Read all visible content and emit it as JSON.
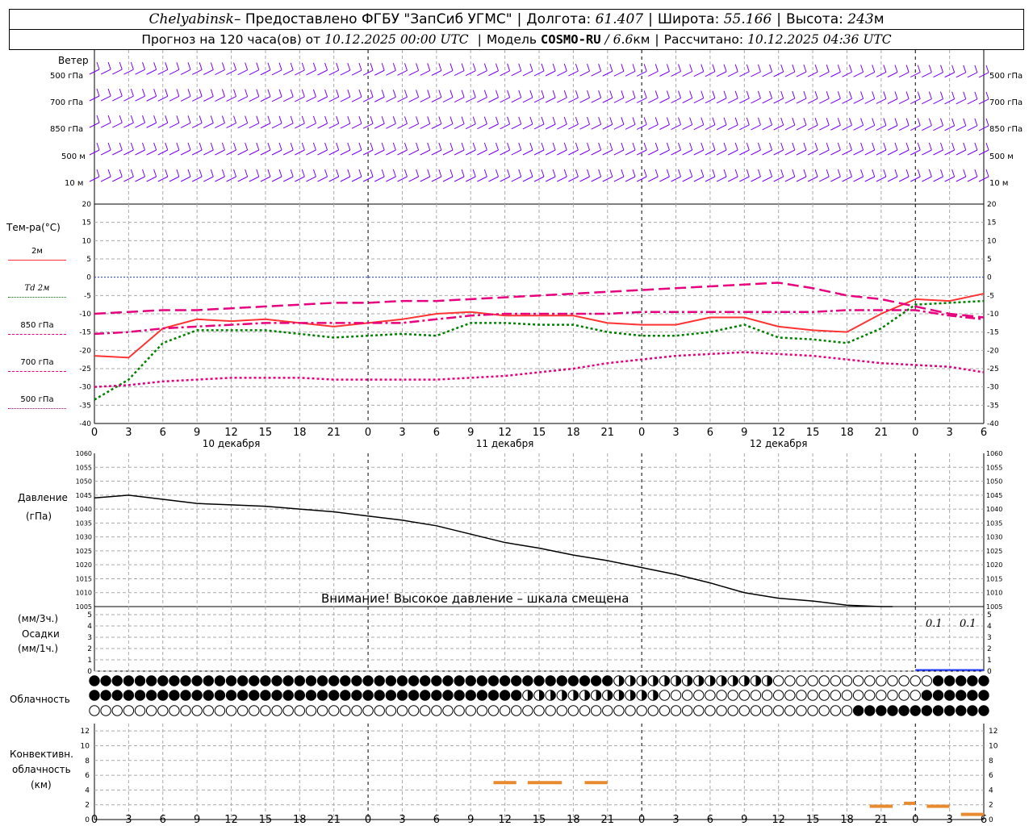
{
  "header": {
    "city": "Chelyabinsk",
    "provider": " – Предоставлено ФГБУ \"ЗапСиб УГМС\"",
    "lon_label": "Долгота:",
    "lon_value": "61.407",
    "lat_label": "Широта:",
    "lat_value": "55.166",
    "alt_label": "Высота:",
    "alt_value": "243",
    "alt_unit": "м",
    "forecast_prefix": "Прогноз на 120 часа(ов) от",
    "forecast_start": "10.12.2025 00:00 UTC",
    "model_label": "Модель",
    "model_name": "COSMO-RU",
    "model_res": "/ 6.6",
    "model_res_unit": "км",
    "calc_label": "Рассчитано:",
    "calc_time": "10.12.2025 04:36 UTC"
  },
  "wind": {
    "title": "Ветер",
    "levels": [
      "500 гПа",
      "700 гПа",
      "850 гПа",
      "500 м",
      "10  м"
    ]
  },
  "temp": {
    "title": "Тем-ра(°C)",
    "legend": [
      {
        "label": "2м",
        "color": "#ff3333"
      },
      {
        "label": "Td  2м",
        "color": "#008000"
      },
      {
        "label": "850 гПа",
        "color": "#e6007e"
      },
      {
        "label": "700 гПа",
        "color": "#e6007e"
      },
      {
        "label": "500 гПа",
        "color": "#e6007e"
      }
    ]
  },
  "pressure": {
    "title": "Давление",
    "unit": "(гПа)",
    "warning": "Внимание! Высокое давление – шкала смещена"
  },
  "precip": {
    "unit3": "(мм/3ч.)",
    "title": "Осадки",
    "unit1": "(мм/1ч.)",
    "labels": [
      "0.1",
      "0.1"
    ]
  },
  "clouds": {
    "title": "Облачность"
  },
  "convective": {
    "title1": "Конвективн.",
    "title2": "облачность",
    "unit": "(км)"
  },
  "time_axis": {
    "ticks": [
      "0",
      "3",
      "6",
      "9",
      "12",
      "15",
      "18",
      "21",
      "0",
      "3",
      "6",
      "9",
      "12",
      "15",
      "18",
      "21",
      "0",
      "3",
      "6",
      "9",
      "12",
      "15",
      "18",
      "21",
      "0",
      "3",
      "6"
    ],
    "days": [
      "10 декабря",
      "11 декабря",
      "12 декабря"
    ]
  },
  "chart_data": [
    {
      "type": "line",
      "title": "Тем-ра(°C)",
      "x": [
        0,
        3,
        6,
        9,
        12,
        15,
        18,
        21,
        24,
        27,
        30,
        33,
        36,
        39,
        42,
        45,
        48,
        51,
        54,
        57,
        60,
        63,
        66,
        69,
        72,
        75,
        78
      ],
      "ylim": [
        -40,
        20
      ],
      "yticks": [
        20,
        15,
        10,
        5,
        0,
        -5,
        -10,
        -15,
        -20,
        -25,
        -30,
        -35,
        -40
      ],
      "grid": true,
      "series": [
        {
          "name": "2м",
          "color": "#ff3333",
          "style": "solid",
          "values": [
            -21.5,
            -22,
            -14,
            -11.5,
            -12,
            -11.5,
            -12.5,
            -13.5,
            -12.5,
            -11.5,
            -10,
            -9.5,
            -10.5,
            -10.5,
            -10.5,
            -12.5,
            -13,
            -13,
            -11,
            -11,
            -13.5,
            -14.5,
            -15,
            -10,
            -6,
            -6.5,
            -4.5
          ]
        },
        {
          "name": "Td  2м",
          "color": "#008000",
          "style": "dotted",
          "values": [
            -33.5,
            -28,
            -18,
            -14.5,
            -14.5,
            -14.5,
            -15.5,
            -16.5,
            -16,
            -15.5,
            -16,
            -12.5,
            -12.5,
            -13,
            -13,
            -15,
            -16,
            -16,
            -15,
            -13,
            -16.5,
            -17,
            -18,
            -14,
            -7.5,
            -7,
            -6.5
          ]
        },
        {
          "name": "850 гПа",
          "color": "#e6007e",
          "style": "dashed",
          "values": [
            -10,
            -9.5,
            -9,
            -9,
            -8.5,
            -8,
            -7.5,
            -7,
            -7,
            -6.5,
            -6.5,
            -6,
            -5.5,
            -5,
            -4.5,
            -4,
            -3.5,
            -3,
            -2.5,
            -2,
            -1.5,
            -3,
            -5,
            -6,
            -8,
            -10,
            -11
          ]
        },
        {
          "name": "700 гПа",
          "color": "#e6007e",
          "style": "dashdot",
          "values": [
            -15.5,
            -15,
            -14,
            -13.5,
            -13,
            -12.5,
            -12.5,
            -12.5,
            -12.5,
            -12.5,
            -11.5,
            -10.5,
            -10,
            -10,
            -10,
            -10,
            -9.5,
            -9.5,
            -9.5,
            -9.5,
            -9.5,
            -9.5,
            -9,
            -9,
            -9,
            -10.5,
            -11.5
          ]
        },
        {
          "name": "500 гПа",
          "color": "#e6007e",
          "style": "dotted",
          "values": [
            -30,
            -29.5,
            -28.5,
            -28,
            -27.5,
            -27.5,
            -27.5,
            -28,
            -28,
            -28,
            -28,
            -27.5,
            -27,
            -26,
            -25,
            -23.5,
            -22.5,
            -21.5,
            -21,
            -20.5,
            -21,
            -21.5,
            -22.5,
            -23.5,
            -24,
            -24.5,
            -26
          ]
        }
      ]
    },
    {
      "type": "line",
      "title": "Давление",
      "ylabel": "(гПа)",
      "ylim": [
        1005,
        1060
      ],
      "yticks": [
        1060,
        1055,
        1050,
        1045,
        1040,
        1035,
        1030,
        1025,
        1020,
        1015,
        1010,
        1005
      ],
      "x": [
        0,
        3,
        6,
        9,
        12,
        15,
        18,
        21,
        24,
        27,
        30,
        33,
        36,
        39,
        42,
        45,
        48,
        51,
        54,
        57,
        60,
        63,
        66,
        69,
        70
      ],
      "series": [
        {
          "name": "",
          "color": "#000000",
          "values": [
            1044,
            1045,
            1043.5,
            1042,
            1041.5,
            1041,
            1040,
            1039,
            1037.5,
            1036,
            1034,
            1031,
            1028,
            1026,
            1023.5,
            1021.5,
            1019,
            1016.5,
            1013.5,
            1010,
            1008,
            1007,
            1005.5,
            1004,
            1003.5
          ]
        }
      ]
    },
    {
      "type": "bar",
      "title": "Осадки",
      "ylim": [
        0,
        5
      ],
      "yticks": [
        5,
        4,
        3,
        2,
        1,
        0
      ],
      "x": [
        75,
        78
      ],
      "values": [
        0.1,
        0.1
      ]
    },
    {
      "type": "bar",
      "title": "Конвективн. облачность",
      "ylabel": "(км)",
      "ylim": [
        0,
        13
      ],
      "yticks": [
        12,
        10,
        8,
        6,
        4,
        2,
        0
      ],
      "segments": [
        {
          "x": [
            35,
            37
          ],
          "y": 5
        },
        {
          "x": [
            38,
            41
          ],
          "y": 5
        },
        {
          "x": [
            43,
            45
          ],
          "y": 5
        },
        {
          "x": [
            68,
            70
          ],
          "y": 1.8
        },
        {
          "x": [
            71,
            72
          ],
          "y": 2.2
        },
        {
          "x": [
            73,
            75
          ],
          "y": 1.8
        },
        {
          "x": [
            76,
            78
          ],
          "y": 0.7
        }
      ]
    }
  ]
}
